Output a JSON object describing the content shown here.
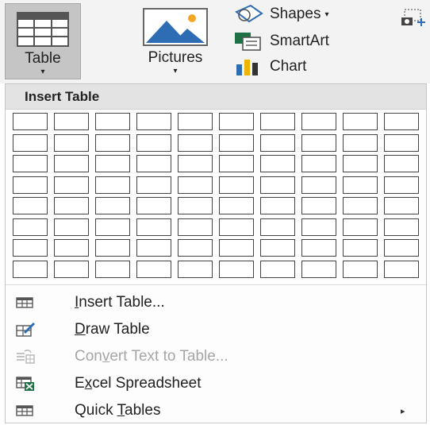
{
  "ribbon": {
    "table_label": "Table",
    "pictures_label": "Pictures",
    "shapes_label": "Shapes",
    "smartart_label": "SmartArt",
    "chart_label": "Chart",
    "caret": "▾",
    "icons": {
      "table": "table-grid-icon",
      "pictures": "picture-icon",
      "shapes": "shapes-icon",
      "smartart": "smartart-icon",
      "chart": "bar-chart-icon",
      "more": "screenshot-icon"
    }
  },
  "dropdown": {
    "header": "Insert Table",
    "grid": {
      "columns": 10,
      "rows": 8
    },
    "items": [
      {
        "pre": "",
        "u": "I",
        "post": "nsert Table...",
        "enabled": true,
        "icon": "insert-table-icon"
      },
      {
        "pre": "",
        "u": "D",
        "post": "raw Table",
        "enabled": true,
        "icon": "draw-table-icon"
      },
      {
        "pre": "Con",
        "u": "v",
        "post": "ert Text to Table...",
        "enabled": false,
        "icon": "convert-text-icon"
      },
      {
        "pre": "E",
        "u": "x",
        "post": "cel Spreadsheet",
        "enabled": true,
        "icon": "excel-icon"
      },
      {
        "pre": "Quick ",
        "u": "T",
        "post": "ables",
        "enabled": true,
        "icon": "quick-tables-icon",
        "submenu": "▸"
      }
    ]
  },
  "colors": {
    "selected_button": "#c5c5c5",
    "header_bg": "#e3e3e3",
    "disabled_text": "#a6a6a6",
    "picture_blue": "#2e6db4",
    "picture_sun": "#f5a623",
    "chart_blue": "#2e6db4",
    "chart_gold": "#f0b400",
    "excel_green": "#1e7145"
  }
}
